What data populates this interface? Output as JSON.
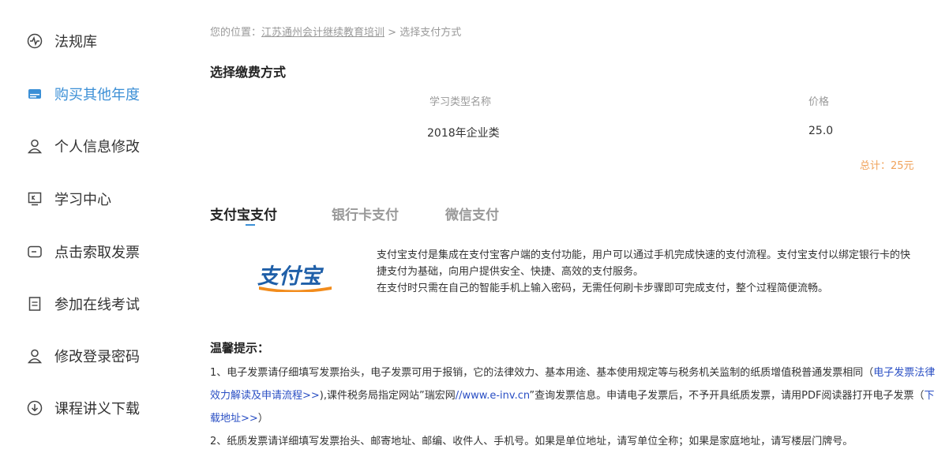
{
  "sidebar": {
    "items": [
      {
        "label": "法规库",
        "icon": "pulse-icon"
      },
      {
        "label": "购买其他年度",
        "icon": "card-icon",
        "active": true
      },
      {
        "label": "个人信息修改",
        "icon": "user-icon"
      },
      {
        "label": "学习中心",
        "icon": "monitor-icon"
      },
      {
        "label": "点击索取发票",
        "icon": "invoice-icon"
      },
      {
        "label": "参加在线考试",
        "icon": "exam-icon"
      },
      {
        "label": "修改登录密码",
        "icon": "user-icon"
      },
      {
        "label": "课程讲义下载",
        "icon": "download-icon"
      }
    ]
  },
  "breadcrumb": {
    "prefix": "您的位置：",
    "link": "江苏通州会计继续教育培训",
    "sep": " > ",
    "current": "选择支付方式"
  },
  "fee": {
    "title": "选择缴费方式",
    "col_name": "学习类型名称",
    "col_price": "价格",
    "row_name": "2018年企业类",
    "row_price": "25.0",
    "total": "总计：25元"
  },
  "tabs": [
    {
      "label": "支付宝支付",
      "active": true
    },
    {
      "label": "银行卡支付"
    },
    {
      "label": "微信支付"
    }
  ],
  "alipay": {
    "logo_text": "支付宝",
    "desc1": "支付宝支付是集成在支付宝客户端的支付功能，用户可以通过手机完成快速的支付流程。支付宝支付以绑定银行卡的快捷支付为基础，向用户提供安全、快捷、高效的支付服务。",
    "desc2": "在支付时只需在自己的智能手机上输入密码，无需任何刷卡步骤即可完成支付，整个过程简便流畅。"
  },
  "tips": {
    "title": "温馨提示：",
    "p1_a": "1、电子发票请仔细填写发票抬头，电子发票可用于报销，它的法律效力、基本用途、基本使用规定等与税务机关监制的纸质增值税普通发票相同（",
    "p1_link1": "电子发票法律 效力解读及申请流程>>",
    "p1_b": "),课件税务局指定网站”瑞宏网",
    "p1_link2": "//www.e-inv.cn",
    "p1_c": "”查询发票信息。申请电子发票后，不予开具纸质发票，请用PDF阅读器打开电子发票（",
    "p1_link3": "下载地址>>",
    "p1_d": "）",
    "p2": "2、纸质发票请详细填写发票抬头、邮寄地址、邮编、收件人、手机号。如果是单位地址，请写单位全称；如果是家庭地址，请写楼层门牌号。"
  },
  "colors": {
    "accent": "#3b8fd6",
    "total": "#f0a25a",
    "link": "#2a4fc4",
    "alipay_blue": "#1f5fa8",
    "alipay_orange": "#f28c1c"
  }
}
